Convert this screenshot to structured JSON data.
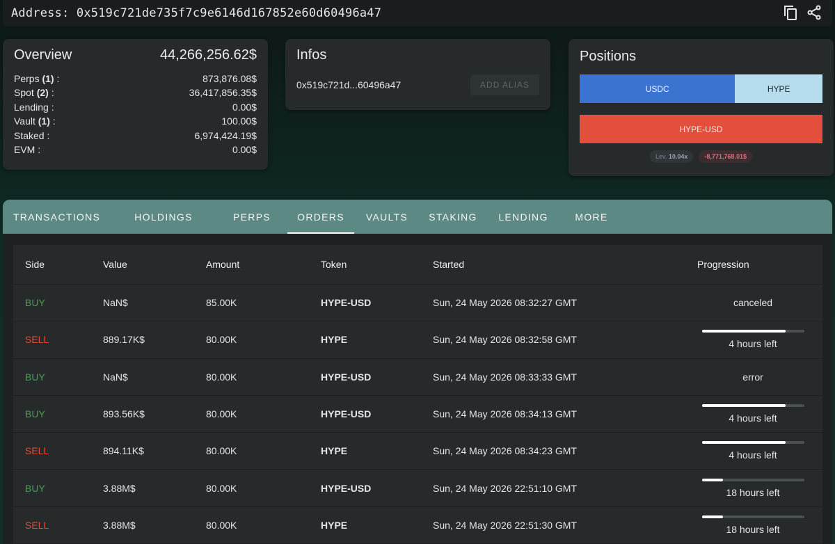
{
  "address_bar": {
    "label": "Address: 0x519c721de735f7c9e6146d167852e60d60496a47",
    "copy_icon": "copy-icon",
    "share_icon": "share-icon"
  },
  "overview": {
    "title": "Overview",
    "total": "44,266,256.62$",
    "rows": [
      {
        "label": "Perps",
        "count": "(1)",
        "suffix": " :",
        "value": "873,876.08$"
      },
      {
        "label": "Spot",
        "count": "(2)",
        "suffix": " :",
        "value": "36,417,856.35$"
      },
      {
        "label": "Lending :",
        "count": "",
        "suffix": "",
        "value": "0.00$"
      },
      {
        "label": "Vault",
        "count": "(1)",
        "suffix": " :",
        "value": "100.00$"
      },
      {
        "label": "Staked :",
        "count": "",
        "suffix": "",
        "value": "6,974,424.19$"
      },
      {
        "label": "EVM :",
        "count": "",
        "suffix": "",
        "value": "0.00$"
      }
    ]
  },
  "infos": {
    "title": "Infos",
    "short_address": "0x519c721d...60496a47",
    "alias_button": "ADD ALIAS"
  },
  "positions": {
    "title": "Positions",
    "bar_left": "USDC",
    "bar_right": "HYPE",
    "bar_left_share": 0.64,
    "pair": "HYPE-USD",
    "lev_label": "Lev.",
    "lev_value": "10.04x",
    "pnl": "-8,771,768.01$",
    "colors": {
      "usdc": "#3b73d1",
      "hype": "#b6dcee",
      "pair": "#e24f3d"
    }
  },
  "tabs": [
    {
      "label": "TRANSACTIONS",
      "active": false
    },
    {
      "label": "HOLDINGS",
      "active": false
    },
    {
      "label": "PERPS",
      "active": false
    },
    {
      "label": "ORDERS",
      "active": true
    },
    {
      "label": "VAULTS",
      "active": false
    },
    {
      "label": "STAKING",
      "active": false
    },
    {
      "label": "LENDING",
      "active": false
    },
    {
      "label": "MORE",
      "active": false
    }
  ],
  "orders": {
    "headers": [
      "Side",
      "Value",
      "Amount",
      "Token",
      "Started",
      "Progression"
    ],
    "rows": [
      {
        "side": "BUY",
        "value": "NaN$",
        "amount": "85.00K",
        "token": "HYPE-USD",
        "started": "Sun, 24 May 2026 08:32:27 GMT",
        "progress_text": "canceled",
        "progress": null
      },
      {
        "side": "SELL",
        "value": "889.17K$",
        "amount": "80.00K",
        "token": "HYPE",
        "started": "Sun, 24 May 2026 08:32:58 GMT",
        "progress_text": "4 hours left",
        "progress": 0.82
      },
      {
        "side": "BUY",
        "value": "NaN$",
        "amount": "80.00K",
        "token": "HYPE-USD",
        "started": "Sun, 24 May 2026 08:33:33 GMT",
        "progress_text": "error",
        "progress": null
      },
      {
        "side": "BUY",
        "value": "893.56K$",
        "amount": "80.00K",
        "token": "HYPE-USD",
        "started": "Sun, 24 May 2026 08:34:13 GMT",
        "progress_text": "4 hours left",
        "progress": 0.82
      },
      {
        "side": "SELL",
        "value": "894.11K$",
        "amount": "80.00K",
        "token": "HYPE",
        "started": "Sun, 24 May 2026 08:34:23 GMT",
        "progress_text": "4 hours left",
        "progress": 0.82
      },
      {
        "side": "BUY",
        "value": "3.88M$",
        "amount": "80.00K",
        "token": "HYPE-USD",
        "started": "Sun, 24 May 2026 22:51:10 GMT",
        "progress_text": "18 hours left",
        "progress": 0.21
      },
      {
        "side": "SELL",
        "value": "3.88M$",
        "amount": "80.00K",
        "token": "HYPE",
        "started": "Sun, 24 May 2026 22:51:30 GMT",
        "progress_text": "18 hours left",
        "progress": 0.21
      }
    ]
  }
}
